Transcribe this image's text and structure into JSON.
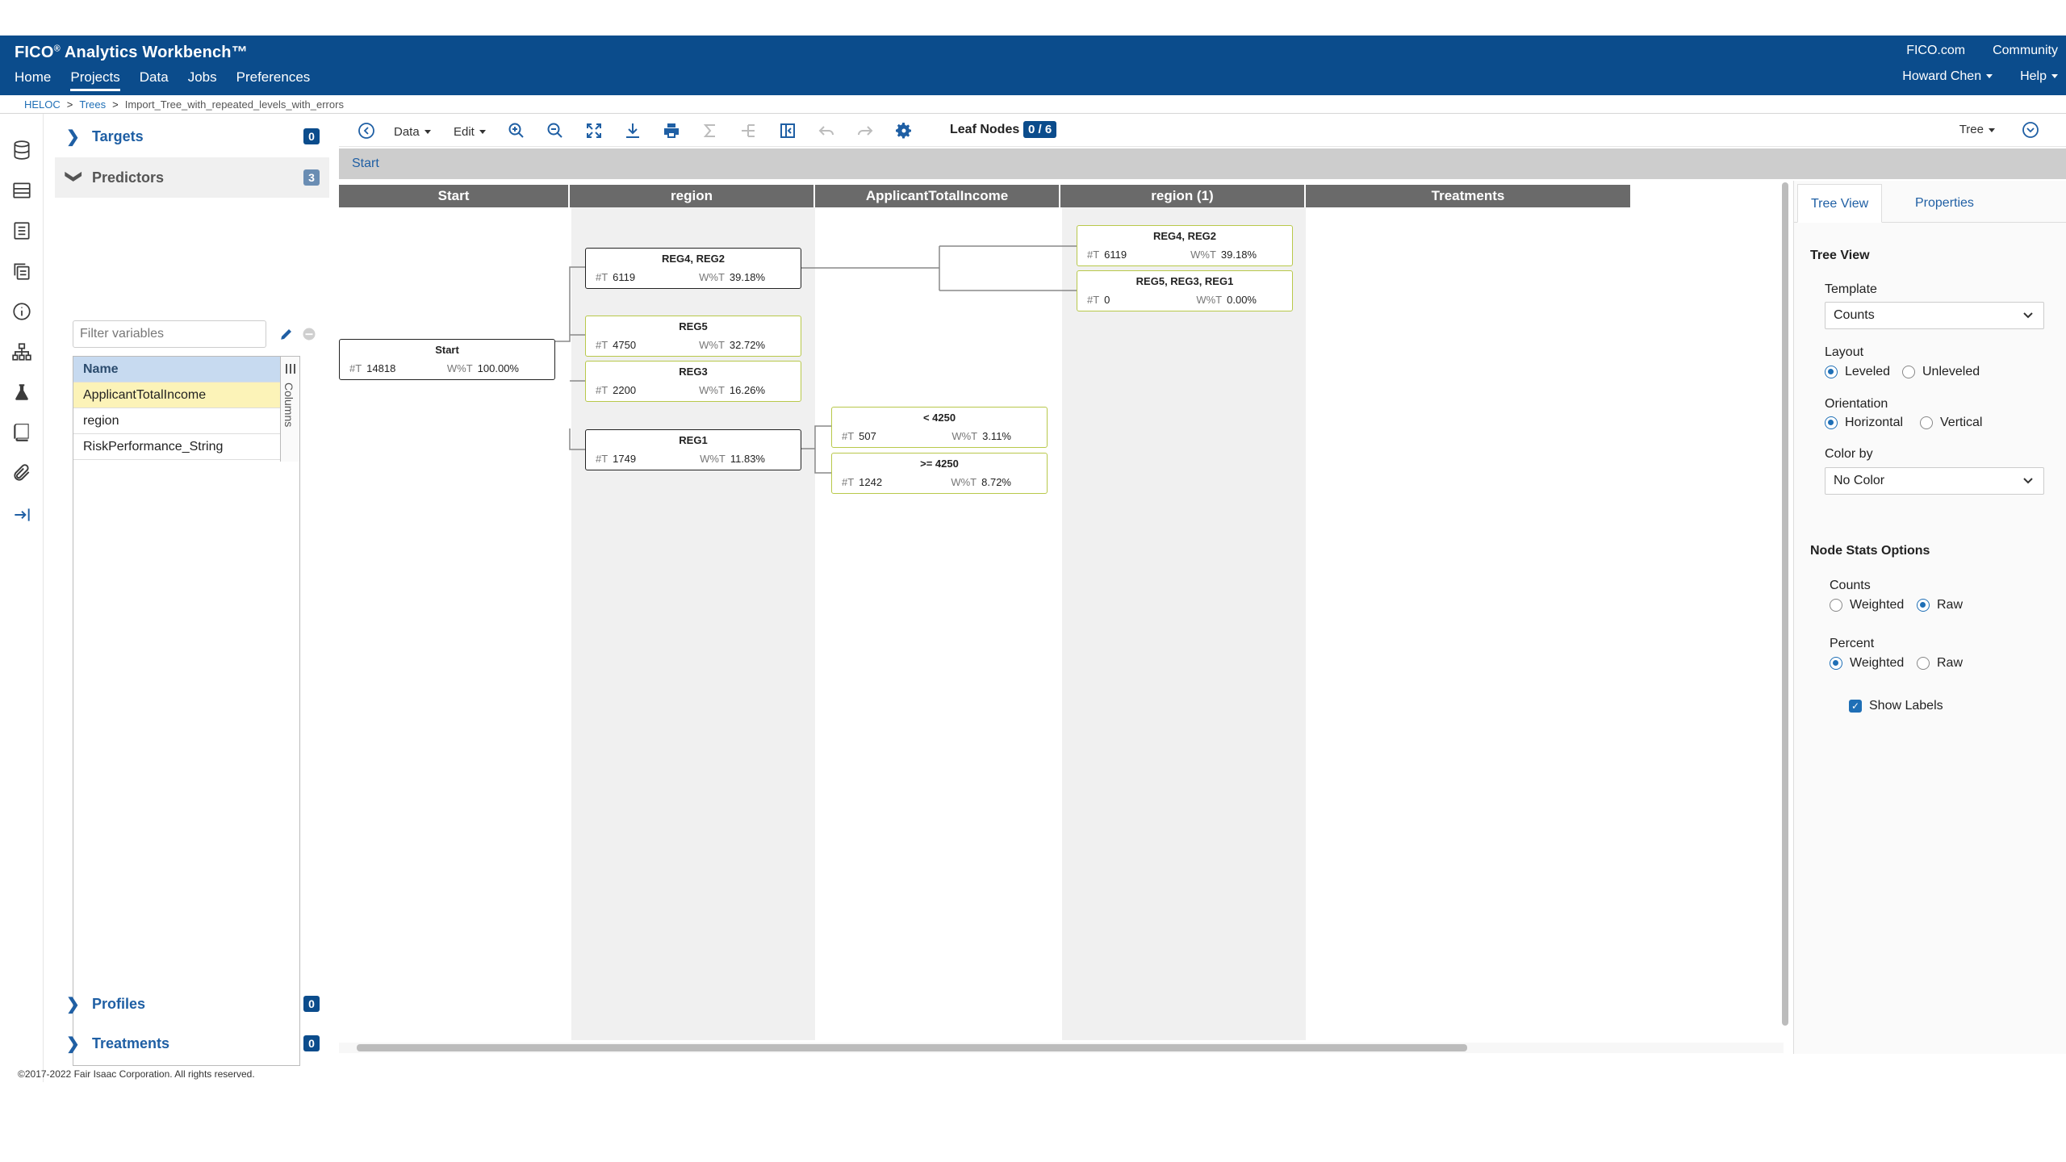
{
  "header": {
    "brand": "FICO",
    "brand_mark": "®",
    "app_name": "Analytics Workbench™",
    "nav": [
      "Home",
      "Projects",
      "Data",
      "Jobs",
      "Preferences"
    ],
    "active_nav": "Projects",
    "links": [
      "FICO.com",
      "Community"
    ],
    "user": "Howard Chen",
    "help": "Help"
  },
  "breadcrumb": {
    "items": [
      "HELOC",
      "Trees",
      "Import_Tree_with_repeated_levels_with_errors"
    ],
    "separator": ">"
  },
  "left_panel": {
    "targets": {
      "label": "Targets",
      "count": "0"
    },
    "predictors": {
      "label": "Predictors",
      "count": "3"
    },
    "filter_placeholder": "Filter variables",
    "table_header": "Name",
    "columns_label": "Columns",
    "variables": [
      "ApplicantTotalIncome",
      "region",
      "RiskPerformance_String"
    ],
    "selected_variable": "ApplicantTotalIncome",
    "profiles": {
      "label": "Profiles",
      "count": "0"
    },
    "treatments": {
      "label": "Treatments",
      "count": "0"
    }
  },
  "footer": {
    "copyright": "©2017-2022 Fair Isaac Corporation. All rights reserved."
  },
  "toolbar": {
    "data_menu": "Data",
    "edit_menu": "Edit",
    "leaf_label": "Leaf Nodes",
    "leaf_count": "0 / 6",
    "view_menu": "Tree",
    "icons": [
      "back-icon",
      "zoom-in-icon",
      "zoom-out-icon",
      "fit-icon",
      "download-icon",
      "print-icon",
      "sum-icon",
      "split-icon",
      "collapse-icon",
      "undo-icon",
      "redo-icon",
      "settings-icon",
      "expand-icon"
    ]
  },
  "path": {
    "current": "Start"
  },
  "tree": {
    "columns": [
      "Start",
      "region",
      "ApplicantTotalIncome",
      "region (1)",
      "Treatments"
    ],
    "count_label": "#T",
    "pct_label": "W%T",
    "nodes": {
      "start": {
        "title": "Start",
        "count": "14818",
        "pct": "100.00%"
      },
      "reg42": {
        "title": "REG4, REG2",
        "count": "6119",
        "pct": "39.18%"
      },
      "reg5": {
        "title": "REG5",
        "count": "4750",
        "pct": "32.72%"
      },
      "reg3": {
        "title": "REG3",
        "count": "2200",
        "pct": "16.26%"
      },
      "reg1": {
        "title": "REG1",
        "count": "1749",
        "pct": "11.83%"
      },
      "lt4250": {
        "title": "< 4250",
        "count": "507",
        "pct": "3.11%"
      },
      "ge4250": {
        "title": ">= 4250",
        "count": "1242",
        "pct": "8.72%"
      },
      "r1_reg42": {
        "title": "REG4, REG2",
        "count": "6119",
        "pct": "39.18%"
      },
      "r1_reg531": {
        "title": "REG5, REG3, REG1",
        "count": "0",
        "pct": "0.00%"
      }
    }
  },
  "right_panel": {
    "tabs": [
      "Tree View",
      "Properties"
    ],
    "active_tab": "Tree View",
    "section_title": "Tree View",
    "template_label": "Template",
    "template_value": "Counts",
    "layout_label": "Layout",
    "layout_options": [
      "Leveled",
      "Unleveled"
    ],
    "layout_selected": "Leveled",
    "orientation_label": "Orientation",
    "orientation_options": [
      "Horizontal",
      "Vertical"
    ],
    "orientation_selected": "Horizontal",
    "colorby_label": "Color by",
    "colorby_value": "No Color",
    "node_stats_title": "Node Stats Options",
    "counts_label": "Counts",
    "counts_options": [
      "Weighted",
      "Raw"
    ],
    "counts_selected": "Raw",
    "percent_label": "Percent",
    "percent_options": [
      "Weighted",
      "Raw"
    ],
    "percent_selected": "Weighted",
    "show_labels": "Show Labels"
  },
  "colors": {
    "brand_blue": "#0b4c8c",
    "link_blue": "#1f6fb6",
    "leaf_border": "#b8c84a",
    "selected_row": "#fcf3b8",
    "column_header": "#6a6a6a"
  }
}
